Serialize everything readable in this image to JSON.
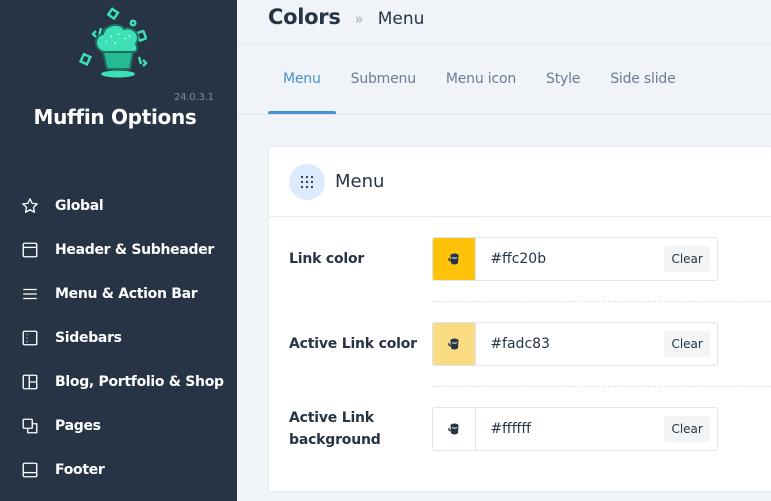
{
  "sidebar": {
    "app_title": "Muffin Options",
    "version": "24.0.3.1",
    "logo_icon": "muffin-logo",
    "items": [
      {
        "label": "Global",
        "icon": "star-icon"
      },
      {
        "label": "Header & Subheader",
        "icon": "browser-window-icon"
      },
      {
        "label": "Menu & Action Bar",
        "icon": "hamburger-menu-icon"
      },
      {
        "label": "Sidebars",
        "icon": "sidebar-panel-icon"
      },
      {
        "label": "Blog, Portfolio & Shop",
        "icon": "layout-grid-icon"
      },
      {
        "label": "Pages",
        "icon": "pages-copy-icon"
      },
      {
        "label": "Footer",
        "icon": "footer-layout-icon"
      }
    ]
  },
  "breadcrumb": {
    "root": "Colors",
    "separator": "»",
    "current": "Menu"
  },
  "tabs": [
    {
      "label": "Menu",
      "active": true
    },
    {
      "label": "Submenu",
      "active": false
    },
    {
      "label": "Menu icon",
      "active": false
    },
    {
      "label": "Style",
      "active": false
    },
    {
      "label": "Side slide",
      "active": false
    }
  ],
  "card": {
    "title": "Menu",
    "icon": "grid-dots-icon",
    "fields": [
      {
        "label": "Link color",
        "value": "#ffc20b",
        "swatch": "#ffc20b",
        "clear_label": "Clear"
      },
      {
        "label": "Active Link color",
        "value": "#fadc83",
        "swatch": "#fadc83",
        "clear_label": "Clear"
      },
      {
        "label_line1": "Active Link",
        "label_line2": "background",
        "value": "#ffffff",
        "swatch": "#ffffff",
        "clear_label": "Clear"
      }
    ]
  },
  "colors": {
    "sidebar_bg": "#263445",
    "accent": "#4a90d0",
    "logo_teal": "#3de0b5"
  }
}
